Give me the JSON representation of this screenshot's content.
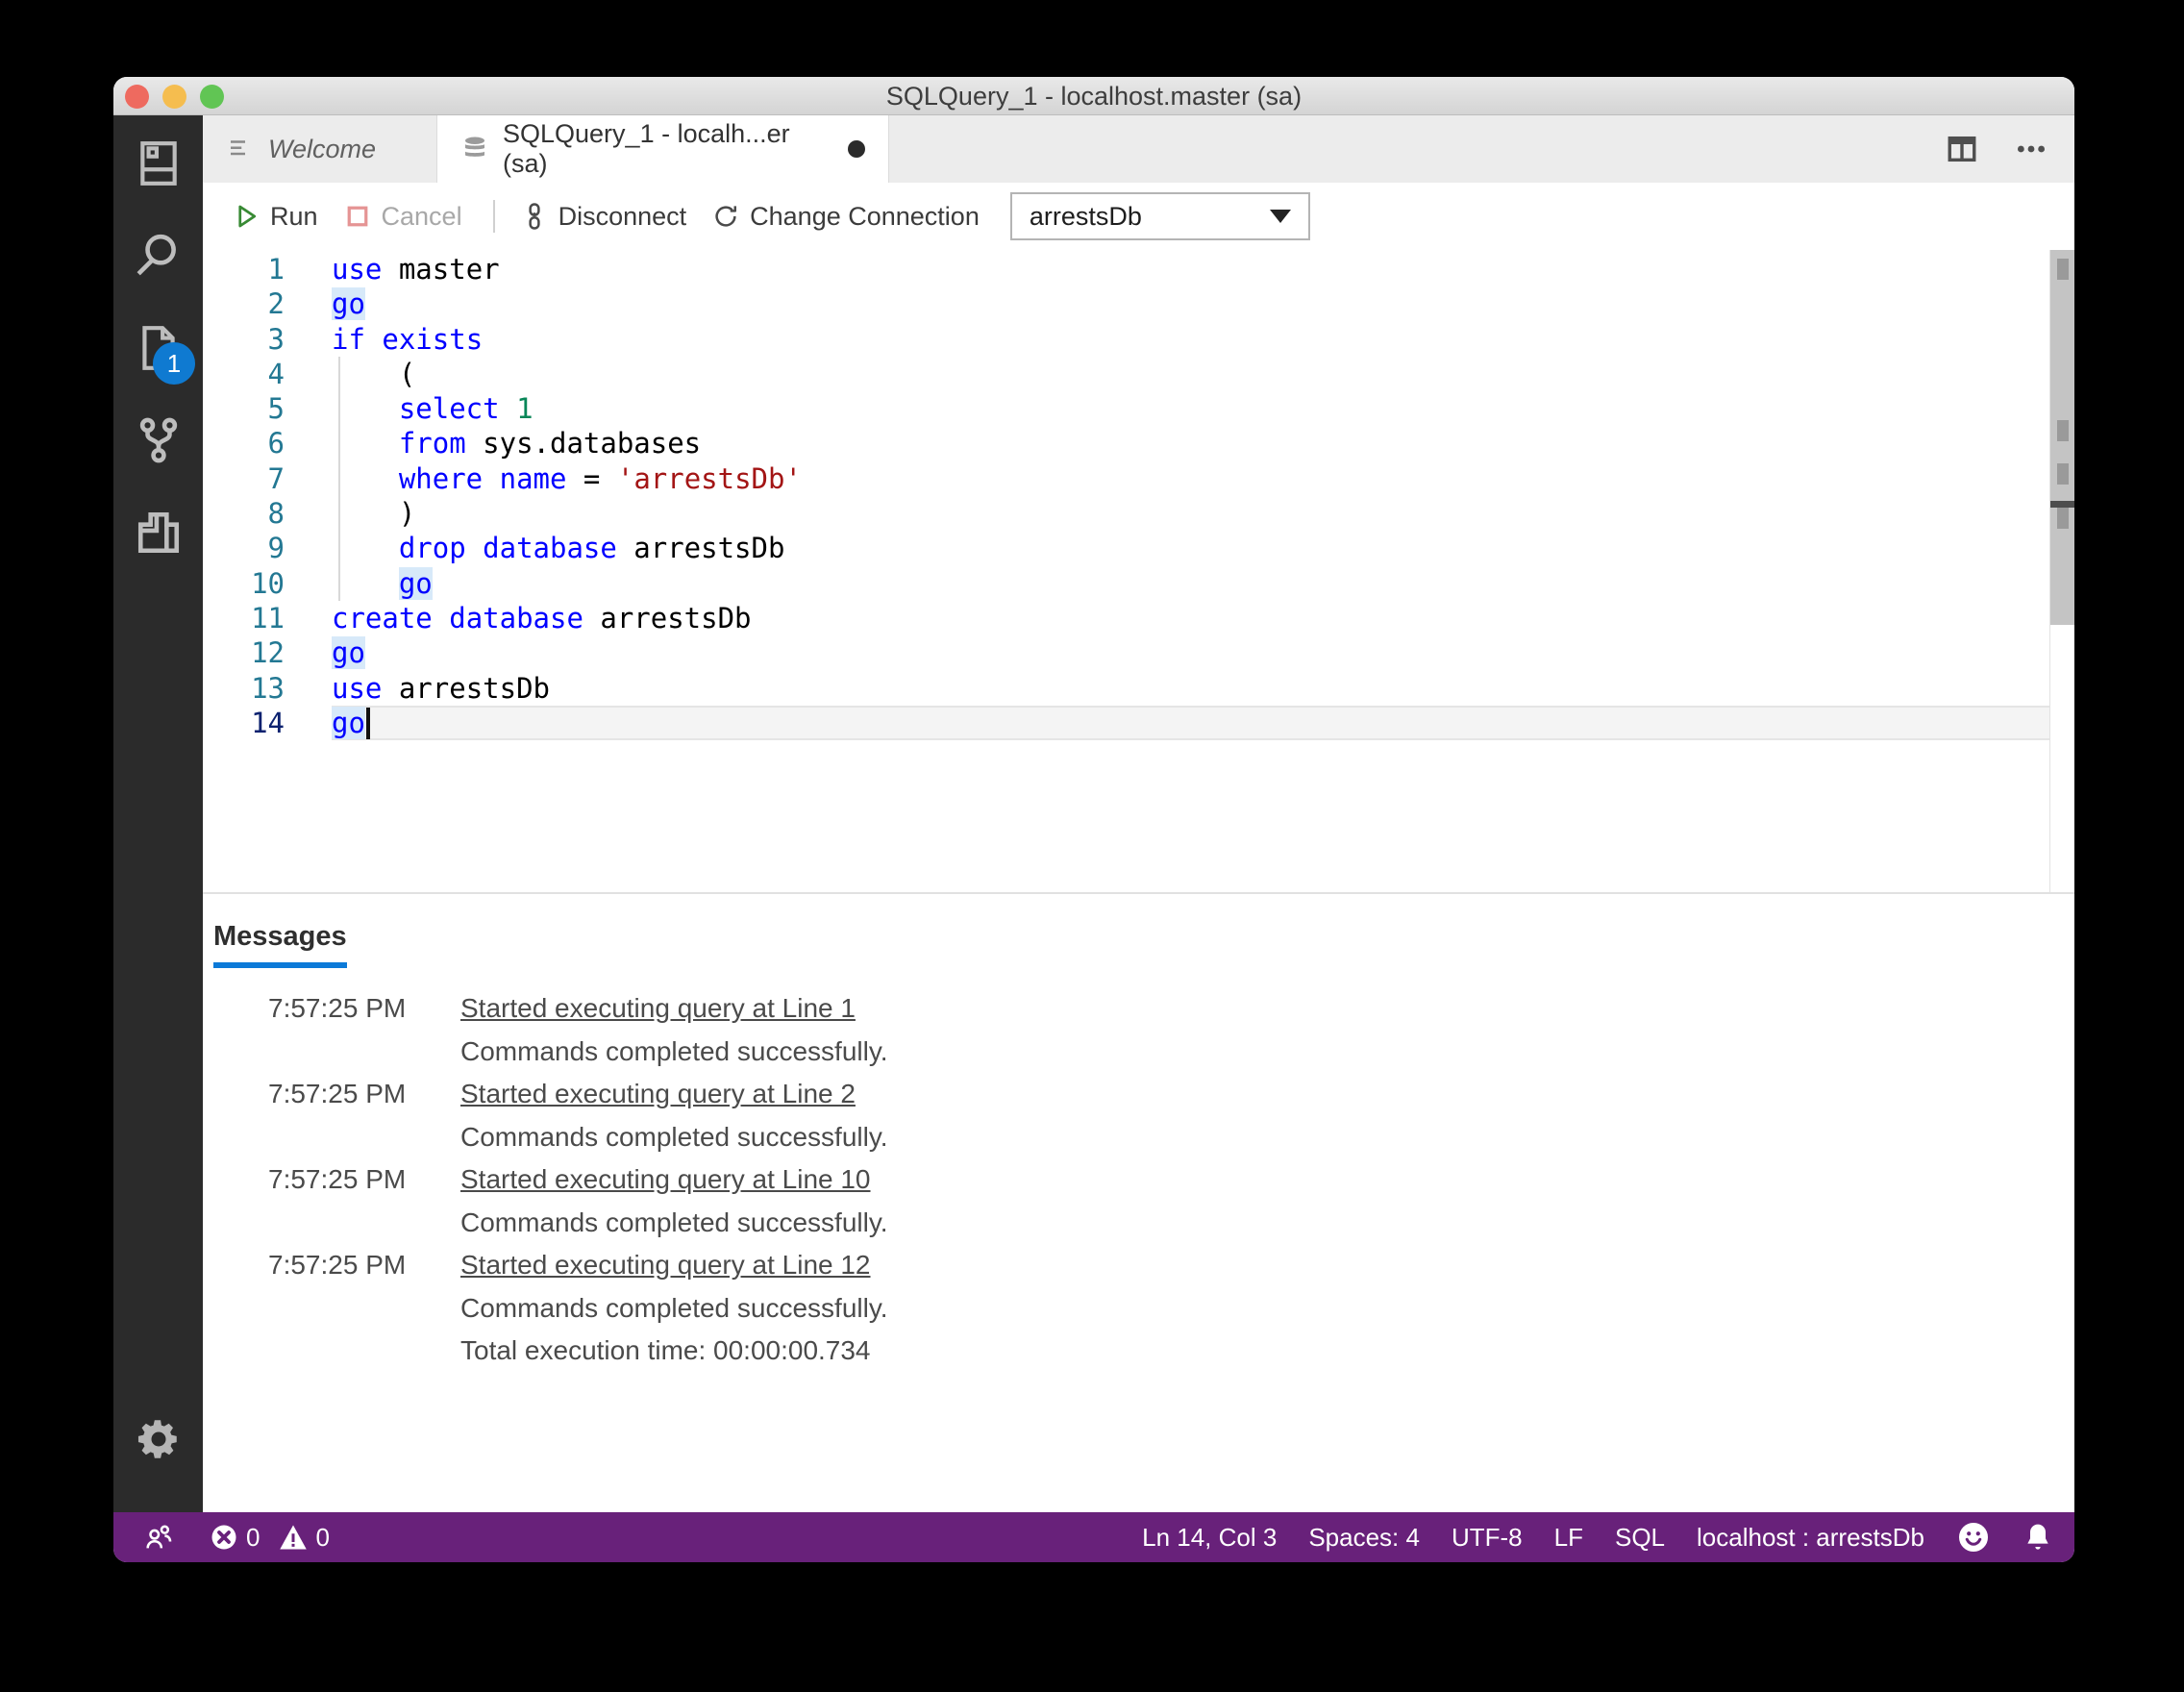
{
  "window": {
    "title": "SQLQuery_1 - localhost.master (sa)"
  },
  "tabs": {
    "welcome": {
      "label": "Welcome"
    },
    "active": {
      "label": "SQLQuery_1 - localh...er (sa)"
    }
  },
  "toolbar": {
    "run": "Run",
    "cancel": "Cancel",
    "disconnect": "Disconnect",
    "change_connection": "Change Connection",
    "database_dropdown": "arrestsDb"
  },
  "activitybar": {
    "badge": "1"
  },
  "editor": {
    "lines": [
      {
        "num": 1,
        "tokens": [
          [
            "kw",
            "use"
          ],
          [
            "pl",
            " master"
          ]
        ]
      },
      {
        "num": 2,
        "tokens": [
          [
            "kwh",
            "go"
          ]
        ]
      },
      {
        "num": 3,
        "tokens": [
          [
            "kw",
            "if"
          ],
          [
            "pl",
            " "
          ],
          [
            "kw",
            "exists"
          ]
        ]
      },
      {
        "num": 4,
        "guide": true,
        "tokens": [
          [
            "pl",
            "    ("
          ]
        ]
      },
      {
        "num": 5,
        "guide": true,
        "tokens": [
          [
            "pl",
            "    "
          ],
          [
            "kw",
            "select"
          ],
          [
            "pl",
            " "
          ],
          [
            "num",
            "1"
          ]
        ]
      },
      {
        "num": 6,
        "guide": true,
        "tokens": [
          [
            "pl",
            "    "
          ],
          [
            "kw",
            "from"
          ],
          [
            "pl",
            " sys.databases"
          ]
        ]
      },
      {
        "num": 7,
        "guide": true,
        "tokens": [
          [
            "pl",
            "    "
          ],
          [
            "kw",
            "where"
          ],
          [
            "pl",
            " "
          ],
          [
            "kw",
            "name"
          ],
          [
            "pl",
            " = "
          ],
          [
            "str",
            "'arrestsDb'"
          ]
        ]
      },
      {
        "num": 8,
        "guide": true,
        "tokens": [
          [
            "pl",
            "    )"
          ]
        ]
      },
      {
        "num": 9,
        "guide": true,
        "tokens": [
          [
            "pl",
            "    "
          ],
          [
            "kw",
            "drop"
          ],
          [
            "pl",
            " "
          ],
          [
            "kw",
            "database"
          ],
          [
            "pl",
            " arrestsDb"
          ]
        ]
      },
      {
        "num": 10,
        "guide": true,
        "tokens": [
          [
            "pl",
            "    "
          ],
          [
            "kwh",
            "go"
          ]
        ]
      },
      {
        "num": 11,
        "tokens": [
          [
            "kw",
            "create"
          ],
          [
            "pl",
            " "
          ],
          [
            "kw",
            "database"
          ],
          [
            "pl",
            " arrestsDb"
          ]
        ]
      },
      {
        "num": 12,
        "tokens": [
          [
            "kwh",
            "go"
          ]
        ]
      },
      {
        "num": 13,
        "tokens": [
          [
            "kw",
            "use"
          ],
          [
            "pl",
            " arrestsDb"
          ]
        ]
      },
      {
        "num": 14,
        "current": true,
        "tokens": [
          [
            "kwh",
            "go"
          ],
          [
            "cursor",
            ""
          ]
        ]
      }
    ],
    "overview": {
      "slider_height": 390,
      "marks": [
        9,
        177,
        222,
        268
      ],
      "current_mark": 261
    }
  },
  "messages": {
    "tab": "Messages",
    "rows": [
      {
        "time": "7:57:25 PM",
        "text": "Started executing query at Line 1",
        "link": true
      },
      {
        "time": "",
        "text": "Commands completed successfully.",
        "link": false
      },
      {
        "time": "7:57:25 PM",
        "text": "Started executing query at Line 2",
        "link": true
      },
      {
        "time": "",
        "text": "Commands completed successfully.",
        "link": false
      },
      {
        "time": "7:57:25 PM",
        "text": "Started executing query at Line 10",
        "link": true
      },
      {
        "time": "",
        "text": "Commands completed successfully.",
        "link": false
      },
      {
        "time": "7:57:25 PM",
        "text": "Started executing query at Line 12",
        "link": true
      },
      {
        "time": "",
        "text": "Commands completed successfully.",
        "link": false
      },
      {
        "time": "",
        "text": "Total execution time: 00:00:00.734",
        "link": false
      }
    ]
  },
  "statusbar": {
    "errors": "0",
    "warnings": "0",
    "right_items": [
      {
        "name": "status-cursor-position",
        "label": "Ln 14, Col 3"
      },
      {
        "name": "status-indentation",
        "label": "Spaces: 4"
      },
      {
        "name": "status-encoding",
        "label": "UTF-8"
      },
      {
        "name": "status-eol",
        "label": "LF"
      },
      {
        "name": "status-language",
        "label": "SQL"
      },
      {
        "name": "status-connection",
        "label": "localhost : arrestsDb"
      }
    ]
  },
  "colors": {
    "statusbar": "#68217a",
    "accent_blue": "#0c7ad8",
    "keyword": "#0000ff",
    "string": "#a31515",
    "number": "#098658",
    "line_number": "#237893",
    "active_line_number": "#0b216f",
    "run_green": "#388a34",
    "cancel_red": "#e59494"
  }
}
